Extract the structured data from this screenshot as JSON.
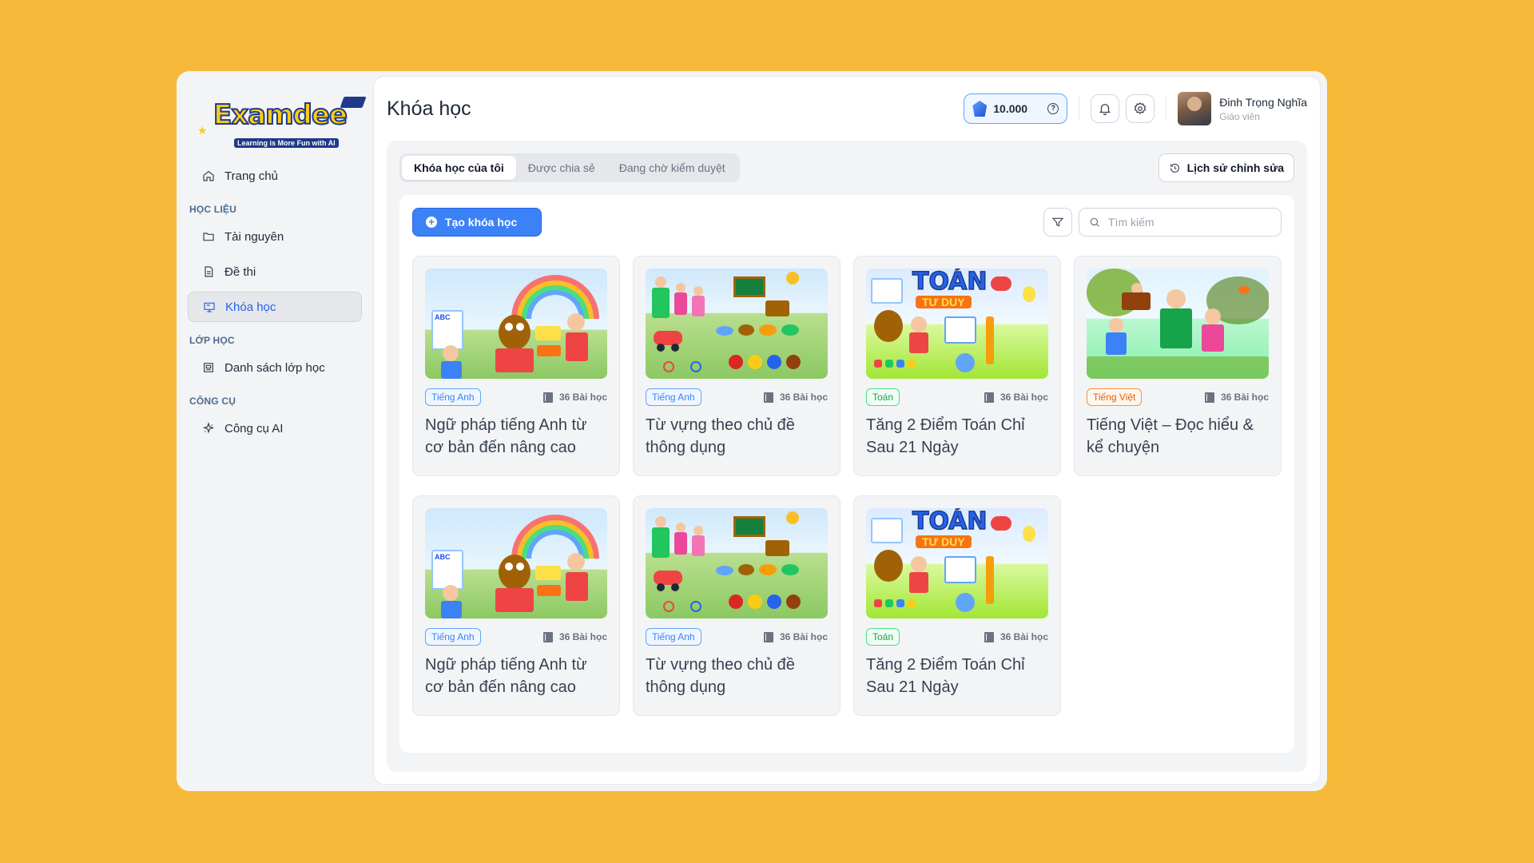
{
  "brand": {
    "logo_text": "Examdee",
    "tagline": "Learning is More Fun with AI"
  },
  "sidebar": {
    "home": "Trang chủ",
    "groups": [
      {
        "title": "HỌC LIỆU",
        "items": [
          "Tài nguyên",
          "Đề thi",
          "Khóa học"
        ]
      },
      {
        "title": "LỚP HỌC",
        "items": [
          "Danh sách lớp học"
        ]
      },
      {
        "title": "CÔNG CỤ",
        "items": [
          "Công cụ AI"
        ]
      }
    ],
    "active_item": "Khóa học"
  },
  "header": {
    "title": "Khóa học",
    "credits": "10.000",
    "user_name": "Đinh Trọng Nghĩa",
    "user_role": "Giáo viên"
  },
  "tabs": [
    {
      "label": "Khóa học của tôi",
      "active": true
    },
    {
      "label": "Được chia sẻ",
      "active": false
    },
    {
      "label": "Đang chờ kiểm duyệt",
      "active": false
    }
  ],
  "history_button": "Lịch sử chỉnh sửa",
  "create_button": "Tạo khóa học",
  "search": {
    "placeholder": "Tìm kiếm",
    "value": ""
  },
  "courses": [
    {
      "subject": "Tiếng Anh",
      "lessons": "36 Bài học",
      "title": "Ngữ pháp tiếng Anh từ cơ bản đến nâng cao"
    },
    {
      "subject": "Tiếng Anh",
      "lessons": "36 Bài học",
      "title": "Từ vựng theo chủ đề thông dụng"
    },
    {
      "subject": "Toán",
      "lessons": "36 Bài học",
      "title": "Tăng 2 Điểm Toán Chỉ Sau 21 Ngày"
    },
    {
      "subject": "Tiếng Việt",
      "lessons": "36 Bài học",
      "title": "Tiếng Việt – Đọc hiểu & kể chuyện"
    },
    {
      "subject": "Tiếng Anh",
      "lessons": "36 Bài học",
      "title": "Ngữ pháp tiếng Anh từ cơ bản đến nâng cao"
    },
    {
      "subject": "Tiếng Anh",
      "lessons": "36 Bài học",
      "title": "Từ vựng theo chủ đề thông dụng"
    },
    {
      "subject": "Toán",
      "lessons": "36 Bài học",
      "title": "Tăng 2 Điểm Toán Chỉ Sau 21 Ngày"
    }
  ],
  "thumb_texts": {
    "math_banner": "TOÁN",
    "math_sub": "TƯ DUY",
    "grammar_label": "ABC"
  },
  "colors": {
    "background": "#F7B93A",
    "accent": "#3B82F6",
    "badge_english": "#3B82F6",
    "badge_math": "#16A34A",
    "badge_vietnamese": "#EA580C"
  },
  "icons": {
    "home": "home-icon",
    "resources": "folder-icon",
    "exams": "document-icon",
    "courses": "course-icon",
    "classes": "classroom-icon",
    "ai_tools": "sparkle-icon",
    "notifications": "bell-icon",
    "settings": "gear-icon",
    "history": "history-icon",
    "filter": "filter-icon",
    "search": "search-icon",
    "lessons": "book-icon"
  }
}
